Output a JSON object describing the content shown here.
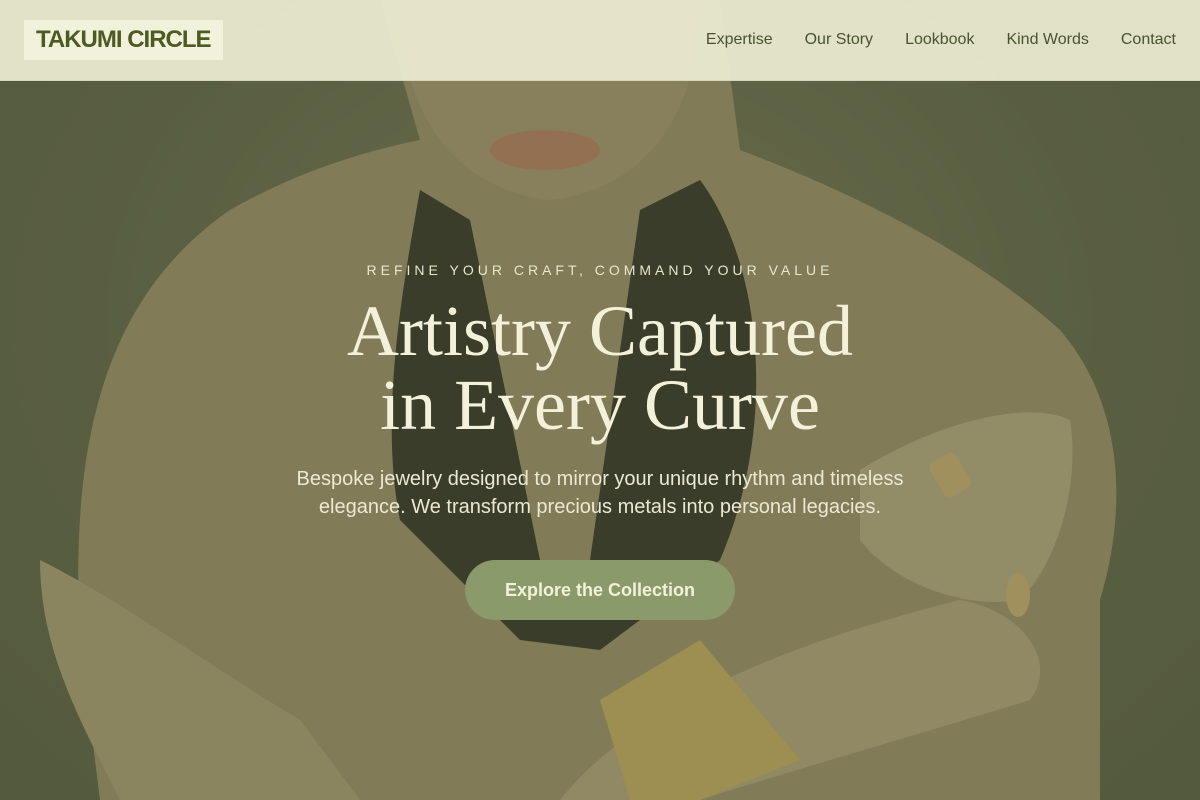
{
  "brand": {
    "logo_text": "TAKUMI CIRCLE"
  },
  "nav": {
    "items": [
      {
        "label": "Expertise"
      },
      {
        "label": "Our Story"
      },
      {
        "label": "Lookbook"
      },
      {
        "label": "Kind Words"
      },
      {
        "label": "Contact"
      }
    ]
  },
  "hero": {
    "eyebrow": "REFINE YOUR CRAFT, COMMAND YOUR VALUE",
    "headline_line1": "Artistry Captured",
    "headline_line2": "in Every Curve",
    "subtext": "Bespoke jewelry designed to mirror your unique rhythm and timeless elegance. We transform precious metals into personal legacies.",
    "cta_label": "Explore the Collection"
  },
  "colors": {
    "accent": "#8a9a6a",
    "logo_text": "#4d5a22",
    "nav_bg": "#ecead2",
    "hero_text": "#f3f1da"
  }
}
